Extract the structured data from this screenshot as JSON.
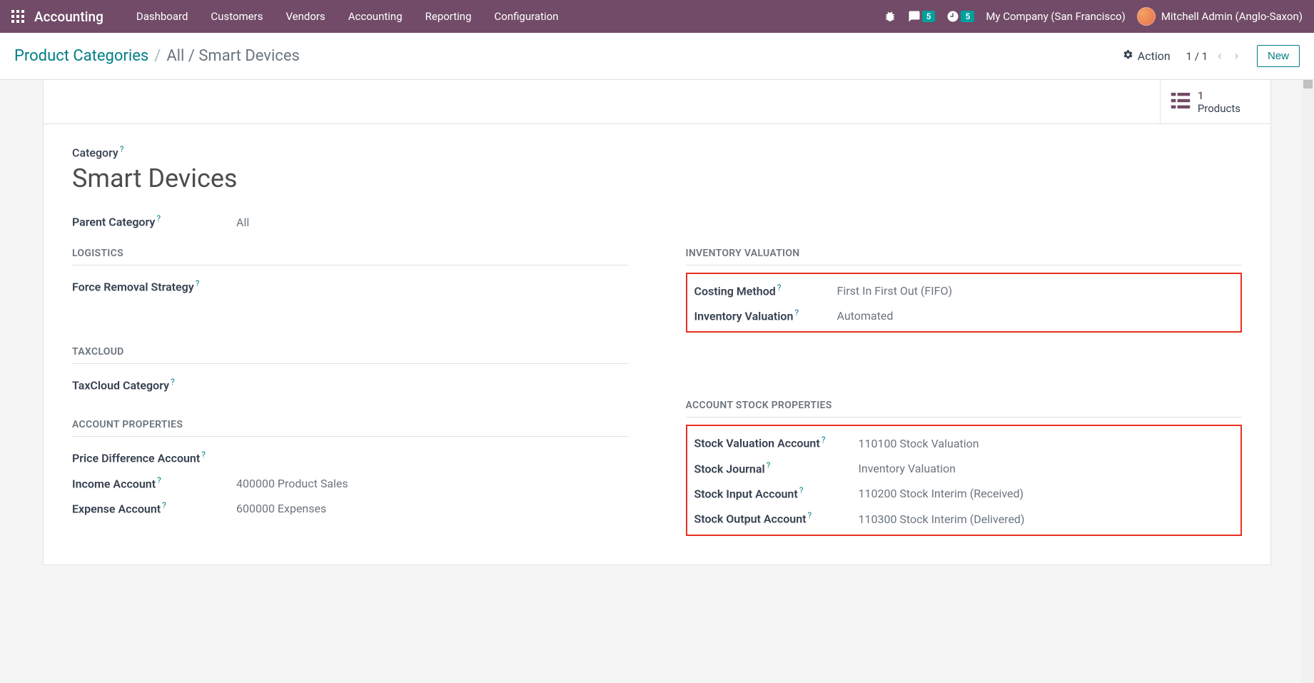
{
  "navbar": {
    "brand": "Accounting",
    "links": [
      "Dashboard",
      "Customers",
      "Vendors",
      "Accounting",
      "Reporting",
      "Configuration"
    ],
    "badge_chat": "5",
    "badge_clock": "5",
    "company": "My Company (San Francisco)",
    "user": "Mitchell Admin (Anglo-Saxon)"
  },
  "breadcrumb": {
    "root": "Product Categories",
    "current": "All / Smart Devices"
  },
  "controls": {
    "action_label": "Action",
    "pager": "1 / 1",
    "new_label": "New"
  },
  "stat": {
    "value": "1",
    "label": "Products"
  },
  "form": {
    "category_label": "Category",
    "category_name": "Smart Devices",
    "parent_label": "Parent Category",
    "parent_value": "All",
    "sections": {
      "logistics": "LOGISTICS",
      "taxcloud": "TAXCLOUD",
      "inventory_valuation": "INVENTORY VALUATION",
      "account_props": "ACCOUNT PROPERTIES",
      "account_stock_props": "ACCOUNT STOCK PROPERTIES"
    },
    "fields": {
      "force_removal": {
        "label": "Force Removal Strategy",
        "value": ""
      },
      "taxcloud_cat": {
        "label": "TaxCloud Category",
        "value": ""
      },
      "costing_method": {
        "label": "Costing Method",
        "value": "First In First Out (FIFO)"
      },
      "inventory_valuation": {
        "label": "Inventory Valuation",
        "value": "Automated"
      },
      "price_diff": {
        "label": "Price Difference Account",
        "value": ""
      },
      "income_account": {
        "label": "Income Account",
        "value": "400000 Product Sales"
      },
      "expense_account": {
        "label": "Expense Account",
        "value": "600000 Expenses"
      },
      "stock_val_account": {
        "label": "Stock Valuation Account",
        "value": "110100 Stock Valuation"
      },
      "stock_journal": {
        "label": "Stock Journal",
        "value": "Inventory Valuation"
      },
      "stock_input": {
        "label": "Stock Input Account",
        "value": "110200 Stock Interim (Received)"
      },
      "stock_output": {
        "label": "Stock Output Account",
        "value": "110300 Stock Interim (Delivered)"
      }
    }
  }
}
